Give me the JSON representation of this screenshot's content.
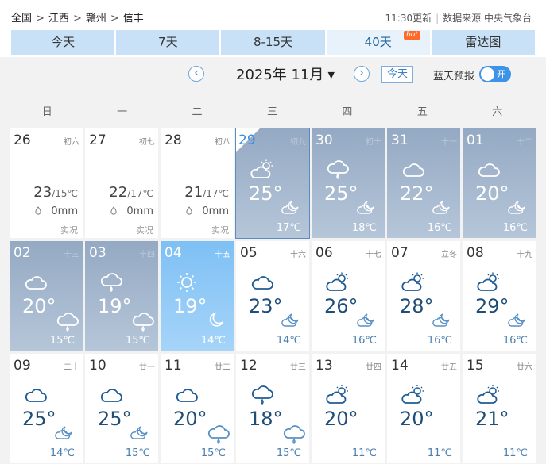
{
  "breadcrumb": [
    "全国",
    "江西",
    "赣州",
    "信丰"
  ],
  "breadcrumb_sep": ">",
  "update": {
    "time": "11:30更新",
    "sep": "|",
    "source": "数据来源 中央气象台"
  },
  "tabs": [
    {
      "label": "今天"
    },
    {
      "label": "7天"
    },
    {
      "label": "8-15天"
    },
    {
      "label": "40天",
      "badge": "hot"
    },
    {
      "label": "雷达图"
    }
  ],
  "nav": {
    "prev": "‹",
    "next": "›",
    "month": "2025年 11月",
    "caret": "▼",
    "today": "今天",
    "bluesky_label": "蓝天预报",
    "toggle_label": "开"
  },
  "weekdays": [
    "日",
    "一",
    "二",
    "三",
    "四",
    "五",
    "六"
  ],
  "days": [
    {
      "day": "26",
      "lunar": "初六",
      "type": "past",
      "hi": "23",
      "lo": "15℃",
      "rain": "0mm",
      "status": "实况"
    },
    {
      "day": "27",
      "lunar": "初七",
      "type": "past",
      "hi": "22",
      "lo": "17℃",
      "rain": "0mm",
      "status": "实况"
    },
    {
      "day": "28",
      "lunar": "初八",
      "type": "past",
      "hi": "21",
      "lo": "17℃",
      "rain": "0mm",
      "status": "实况"
    },
    {
      "day": "29",
      "lunar": "初九",
      "type": "gray",
      "today": true,
      "icon": "partly-sunny-cloud",
      "hi": "25°",
      "night": "cloud-moon",
      "lo": "17℃"
    },
    {
      "day": "30",
      "lunar": "初十",
      "type": "gray",
      "icon": "rain-cloud",
      "hi": "25°",
      "night": "cloud-moon",
      "lo": "18℃"
    },
    {
      "day": "31",
      "lunar": "十一",
      "type": "gray",
      "icon": "cloud",
      "hi": "22°",
      "night": "cloud-moon",
      "lo": "16℃"
    },
    {
      "day": "01",
      "lunar": "十二",
      "type": "gray",
      "icon": "cloud",
      "hi": "20°",
      "night": "cloud-moon",
      "lo": "16℃"
    },
    {
      "day": "02",
      "lunar": "十三",
      "type": "gray",
      "icon": "cloud",
      "hi": "20°",
      "night": "rain-cloud",
      "lo": "15℃"
    },
    {
      "day": "03",
      "lunar": "十四",
      "type": "gray",
      "icon": "rain-cloud",
      "hi": "19°",
      "night": "rain-cloud",
      "lo": "15℃"
    },
    {
      "day": "04",
      "lunar": "十五",
      "type": "sun",
      "icon": "sun",
      "hi": "19°",
      "night": "moon",
      "lo": "14℃"
    },
    {
      "day": "05",
      "lunar": "十六",
      "type": "future",
      "icon": "cloud",
      "hi": "23°",
      "night": "cloud-moon",
      "lo": "14℃"
    },
    {
      "day": "06",
      "lunar": "十七",
      "type": "future",
      "icon": "partly-sunny-cloud",
      "hi": "26°",
      "night": "cloud-moon",
      "lo": "16℃"
    },
    {
      "day": "07",
      "lunar": "立冬",
      "type": "future",
      "icon": "partly-sunny-cloud",
      "hi": "28°",
      "night": "cloud-moon",
      "lo": "16℃"
    },
    {
      "day": "08",
      "lunar": "十九",
      "type": "future",
      "icon": "partly-sunny-cloud",
      "hi": "29°",
      "night": "cloud-moon",
      "lo": "16℃"
    },
    {
      "day": "09",
      "lunar": "二十",
      "type": "future",
      "icon": "cloud",
      "hi": "25°",
      "night": "cloud-moon",
      "lo": "14℃"
    },
    {
      "day": "10",
      "lunar": "廿一",
      "type": "future",
      "icon": "cloud",
      "hi": "25°",
      "night": "cloud-moon",
      "lo": "15℃"
    },
    {
      "day": "11",
      "lunar": "廿二",
      "type": "future",
      "icon": "cloud",
      "hi": "20°",
      "night": "rain-cloud",
      "lo": "15℃"
    },
    {
      "day": "12",
      "lunar": "廿三",
      "type": "future",
      "icon": "rain-cloud",
      "hi": "18°",
      "night": "rain-cloud",
      "lo": "15℃"
    },
    {
      "day": "13",
      "lunar": "廿四",
      "type": "future",
      "icon": "partly-sunny-cloud",
      "hi": "20°",
      "night": "",
      "lo": "11℃"
    },
    {
      "day": "14",
      "lunar": "廿五",
      "type": "future",
      "icon": "partly-sunny-cloud",
      "hi": "20°",
      "night": "",
      "lo": "11℃"
    },
    {
      "day": "15",
      "lunar": "廿六",
      "type": "future",
      "icon": "partly-sunny-cloud",
      "hi": "21°",
      "night": "",
      "lo": "11℃"
    }
  ],
  "colors": {
    "tab_bg": "#c8e1f7",
    "accent": "#3e93e6",
    "gray_cell": "#94a9c3",
    "sun_cell": "#7ec0f5",
    "temp_text": "#1e4d78"
  }
}
